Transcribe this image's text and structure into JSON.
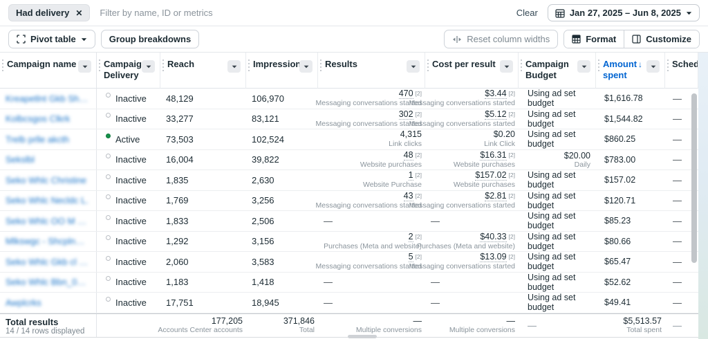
{
  "filter_bar": {
    "chip": "Had delivery",
    "placeholder": "Filter by name, ID or metrics",
    "clear": "Clear",
    "date_range": "Jan 27, 2025 – Jun 8, 2025"
  },
  "toolbar": {
    "pivot_table": "Pivot table",
    "group_breakdowns": "Group breakdowns",
    "reset_column_widths": "Reset column widths",
    "format": "Format",
    "customize": "Customize"
  },
  "table": {
    "names_blurred": true,
    "columns": [
      {
        "label": "Campaign name"
      },
      {
        "label": "Campaign Delivery"
      },
      {
        "label": "Reach"
      },
      {
        "label": "Impressions"
      },
      {
        "label": "Results"
      },
      {
        "label": "Cost per result"
      },
      {
        "label": "Campaign Budget"
      },
      {
        "label": "Amount spent",
        "sorted": "desc"
      },
      {
        "label": "Sched",
        "truncated": true
      }
    ],
    "rows": [
      {
        "name": "Kreapetlnt Gkb Sho...",
        "status": "Inactive",
        "active": false,
        "reach": "48,129",
        "impressions": "106,970",
        "results": {
          "v": "470",
          "ref": "[2]",
          "label": "Messaging conversations started"
        },
        "cost": {
          "v": "$3.44",
          "ref": "[2]",
          "label": "Messaging conversations started"
        },
        "budget": {
          "v": "Using ad set budget",
          "sub": ""
        },
        "spent": "$1,616.78",
        "sched": "—"
      },
      {
        "name": "Kolbcsgos Clkrk",
        "status": "Inactive",
        "active": false,
        "reach": "33,277",
        "impressions": "83,121",
        "results": {
          "v": "302",
          "ref": "[2]",
          "label": "Messaging conversations started"
        },
        "cost": {
          "v": "$5.12",
          "ref": "[2]",
          "label": "Messaging conversations started"
        },
        "budget": {
          "v": "Using ad set budget",
          "sub": ""
        },
        "spent": "$1,544.82",
        "sched": "—"
      },
      {
        "name": "Trelb prlle akcth",
        "status": "Active",
        "active": true,
        "reach": "73,503",
        "impressions": "102,524",
        "results": {
          "v": "4,315",
          "ref": "",
          "label": "Link clicks"
        },
        "cost": {
          "v": "$0.20",
          "ref": "",
          "label": "Link Click"
        },
        "budget": {
          "v": "Using ad set budget",
          "sub": ""
        },
        "spent": "$860.25",
        "sched": "—"
      },
      {
        "name": "Sekslbl",
        "status": "Inactive",
        "active": false,
        "reach": "16,004",
        "impressions": "39,822",
        "results": {
          "v": "48",
          "ref": "[2]",
          "label": "Website purchases"
        },
        "cost": {
          "v": "$16.31",
          "ref": "[2]",
          "label": "Website purchases"
        },
        "budget": {
          "v": "$20.00",
          "sub": "Daily"
        },
        "spent": "$783.00",
        "sched": "—"
      },
      {
        "name": "Seko Whlc Christine",
        "status": "Inactive",
        "active": false,
        "reach": "1,835",
        "impressions": "2,630",
        "results": {
          "v": "1",
          "ref": "[2]",
          "label": "Website Purchase"
        },
        "cost": {
          "v": "$157.02",
          "ref": "[2]",
          "label": "Website purchases"
        },
        "budget": {
          "v": "Using ad set budget",
          "sub": ""
        },
        "spent": "$157.02",
        "sched": "—"
      },
      {
        "name": "Seko Whlc Necldc  L.",
        "status": "Inactive",
        "active": false,
        "reach": "1,769",
        "impressions": "3,256",
        "results": {
          "v": "43",
          "ref": "[2]",
          "label": "Messaging conversations started"
        },
        "cost": {
          "v": "$2.81",
          "ref": "[2]",
          "label": "Messaging conversations started"
        },
        "budget": {
          "v": "Using ad set budget",
          "sub": ""
        },
        "spent": "$120.71",
        "sched": "—"
      },
      {
        "name": "Seko Whlc OO M Glen",
        "status": "Inactive",
        "active": false,
        "reach": "1,833",
        "impressions": "2,506",
        "results": {
          "v": "—",
          "ref": "",
          "label": ""
        },
        "cost": {
          "v": "—",
          "ref": "",
          "label": ""
        },
        "budget": {
          "v": "Using ad set budget",
          "sub": ""
        },
        "spent": "$85.23",
        "sched": "—"
      },
      {
        "name": "Mlkswgc - Shcplng ca...",
        "status": "Inactive",
        "active": false,
        "reach": "1,292",
        "impressions": "3,156",
        "results": {
          "v": "2",
          "ref": "[2]",
          "label": "Purchases (Meta and website)"
        },
        "cost": {
          "v": "$40.33",
          "ref": "[2]",
          "label": "Purchases (Meta and website)"
        },
        "budget": {
          "v": "Using ad set budget",
          "sub": ""
        },
        "spent": "$80.66",
        "sched": "—"
      },
      {
        "name": "Seko Whlc Gkb cl Bus...",
        "status": "Inactive",
        "active": false,
        "reach": "2,060",
        "impressions": "3,583",
        "results": {
          "v": "5",
          "ref": "[2]",
          "label": "Messaging conversations started"
        },
        "cost": {
          "v": "$13.09",
          "ref": "[2]",
          "label": "Messaging conversations started"
        },
        "budget": {
          "v": "Using ad set budget",
          "sub": ""
        },
        "spent": "$65.47",
        "sched": "—"
      },
      {
        "name": "Seko Whlc Bbn_04_grls",
        "status": "Inactive",
        "active": false,
        "reach": "1,183",
        "impressions": "1,418",
        "results": {
          "v": "—",
          "ref": "",
          "label": ""
        },
        "cost": {
          "v": "—",
          "ref": "",
          "label": ""
        },
        "budget": {
          "v": "Using ad set budget",
          "sub": ""
        },
        "spent": "$52.62",
        "sched": "—"
      },
      {
        "name": "Awplcrks",
        "status": "Inactive",
        "active": false,
        "reach": "17,751",
        "impressions": "18,945",
        "results": {
          "v": "—",
          "ref": "",
          "label": ""
        },
        "cost": {
          "v": "—",
          "ref": "",
          "label": ""
        },
        "budget": {
          "v": "Using ad set budget",
          "sub": ""
        },
        "spent": "$49.41",
        "sched": "—"
      }
    ],
    "footer": {
      "title": "Total results",
      "rows_displayed": "14 / 14 rows displayed",
      "reach": {
        "v": "177,205",
        "label": "Accounts Center accounts"
      },
      "impressions": {
        "v": "371,846",
        "label": "Total"
      },
      "results": {
        "v": "—",
        "label": "Multiple conversions"
      },
      "cost": {
        "v": "—",
        "label": "Multiple conversions"
      },
      "budget": "—",
      "spent": {
        "v": "$5,513.57",
        "label": "Total spent"
      },
      "sched": "—"
    }
  },
  "colors": {
    "link_blue": "#0064d1",
    "sorted_header_blue": "#0064d1",
    "active_green": "#17914b",
    "inactive_gray": "#b9bdc3",
    "text": "#1c2b33",
    "muted": "#8a949c"
  }
}
